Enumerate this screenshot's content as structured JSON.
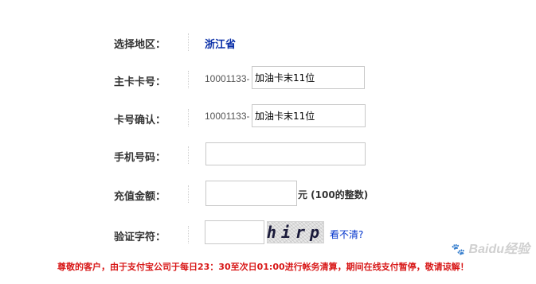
{
  "form": {
    "region": {
      "label": "选择地区：",
      "value": "浙江省"
    },
    "card_number": {
      "label": "主卡卡号：",
      "prefix": "10001133-",
      "value": "加油卡末11位"
    },
    "card_confirm": {
      "label": "卡号确认：",
      "prefix": "10001133-",
      "value": "加油卡末11位"
    },
    "phone": {
      "label": "手机号码：",
      "value": ""
    },
    "amount": {
      "label": "充值金额：",
      "value": "",
      "unit": "元 (100的整数)"
    },
    "captcha": {
      "label": "验证字符：",
      "value": "",
      "image_text": "hirp",
      "refresh_label": "看不清?"
    }
  },
  "notice": "尊敬的客户，由于支付宝公司于每日23：30至次日01:00进行帐务清算，期间在线支付暂停，敬请谅解！",
  "watermark": {
    "icon": "baidu-paw-icon",
    "text": "Baidu经验"
  },
  "colors": {
    "region_value": "#0a2fa8",
    "notice": "#d81818",
    "link": "#0033cc"
  }
}
